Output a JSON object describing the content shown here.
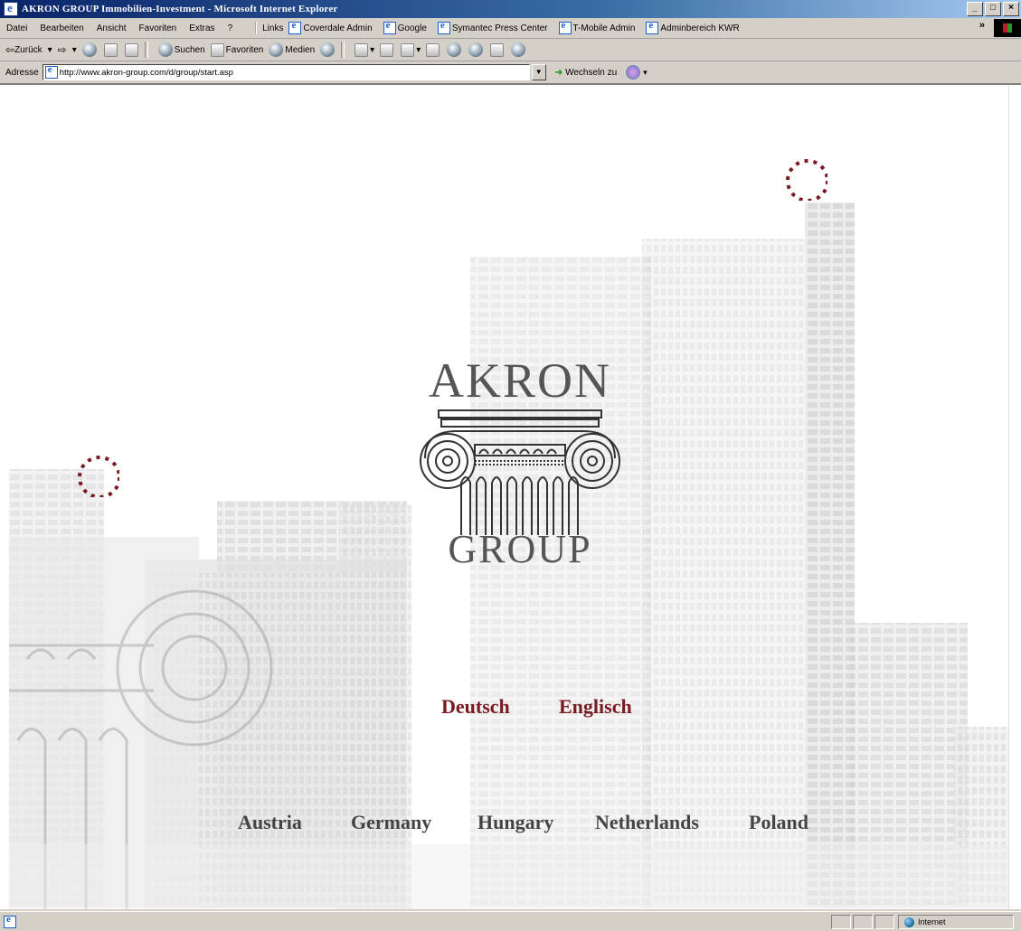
{
  "window": {
    "title": "AKRON GROUP Immobilien-Investment - Microsoft Internet Explorer",
    "buttons": [
      "_",
      "□",
      "×"
    ]
  },
  "menu": {
    "items": [
      "Datei",
      "Bearbeiten",
      "Ansicht",
      "Favoriten",
      "Extras",
      "?"
    ],
    "links_label": "Links",
    "links": [
      "Coverdale Admin",
      "Google",
      "Symantec Press Center",
      "T-Mobile Admin",
      "Adminbereich KWR"
    ],
    "overflow": "»"
  },
  "toolbar": {
    "back": "Zurück",
    "search": "Suchen",
    "favorites": "Favoriten",
    "media": "Medien"
  },
  "address": {
    "label": "Adresse",
    "url": "http://www.akron-group.com/d/group/start.asp",
    "go_label": "Wechseln zu"
  },
  "page": {
    "logo_top": "AKRON",
    "logo_bottom": "GROUP",
    "languages": [
      "Deutsch",
      "Englisch"
    ],
    "countries": [
      "Austria",
      "Germany",
      "Hungary",
      "Netherlands",
      "Poland"
    ],
    "accent_color": "#7a1b22"
  },
  "status": {
    "zone": "Internet"
  }
}
